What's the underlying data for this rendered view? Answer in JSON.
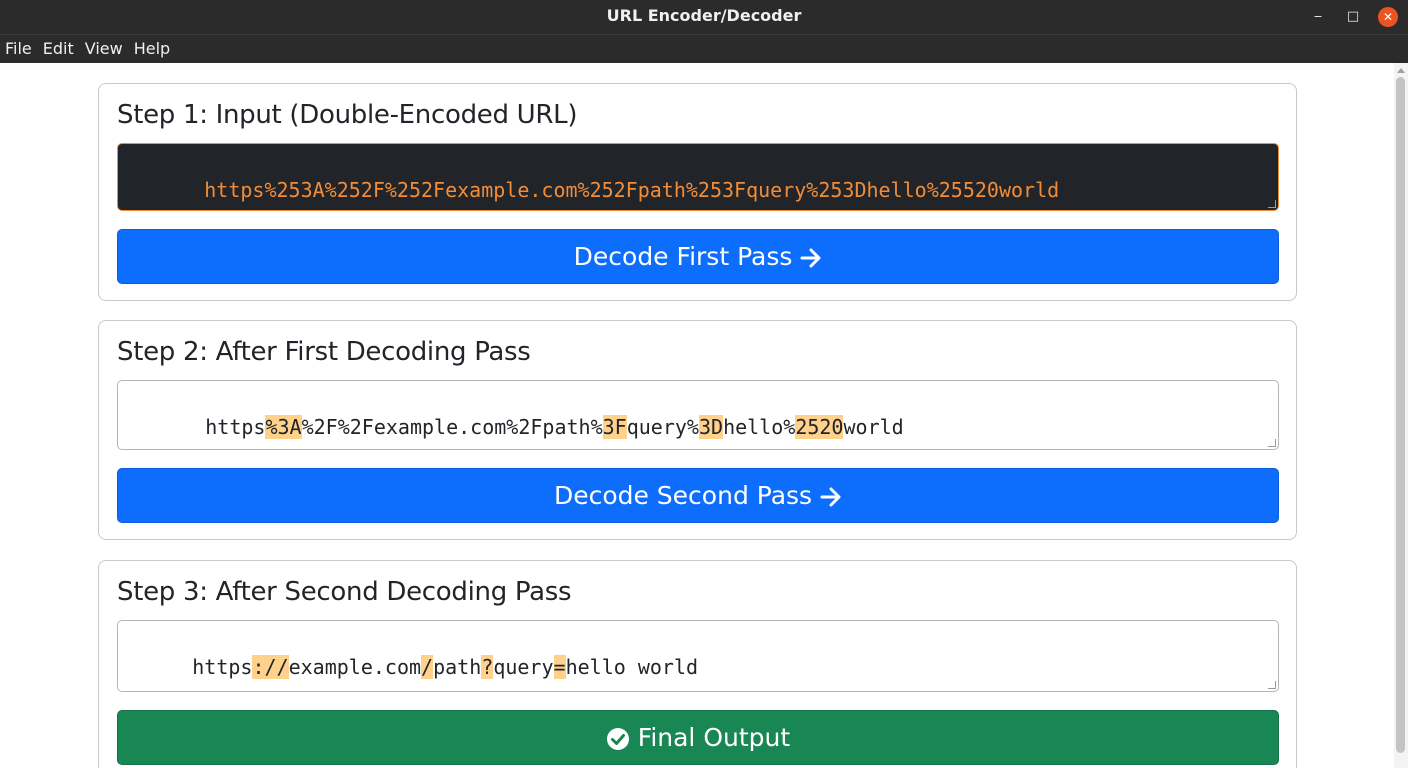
{
  "window": {
    "title": "URL Encoder/Decoder",
    "minimize": "‒",
    "maximize": "□",
    "close": "✕"
  },
  "menu": [
    "File",
    "Edit",
    "View",
    "Help"
  ],
  "steps": [
    {
      "title": "Step 1: Input (Double-Encoded URL)",
      "field_segments": [
        {
          "text": "https%253A%252F%252Fexample.com%252Fpath%253Fquery%253Dhello%25520world",
          "hl": false
        }
      ],
      "button_label": "Decode First Pass"
    },
    {
      "title": "Step 2: After First Decoding Pass",
      "field_segments": [
        {
          "text": "https",
          "hl": false
        },
        {
          "text": "%3A",
          "hl": true
        },
        {
          "text": "%2F%2Fexample.com%2Fpath%",
          "hl": false
        },
        {
          "text": "3F",
          "hl": true
        },
        {
          "text": "query%",
          "hl": false
        },
        {
          "text": "3D",
          "hl": true
        },
        {
          "text": "hello%",
          "hl": false
        },
        {
          "text": "2520",
          "hl": true
        },
        {
          "text": "world",
          "hl": false
        }
      ],
      "button_label": "Decode Second Pass"
    },
    {
      "title": "Step 3: After Second Decoding Pass",
      "field_segments": [
        {
          "text": "https",
          "hl": false
        },
        {
          "text": "://",
          "hl": true
        },
        {
          "text": "example.com",
          "hl": false
        },
        {
          "text": "/",
          "hl": true
        },
        {
          "text": "path",
          "hl": false
        },
        {
          "text": "?",
          "hl": true
        },
        {
          "text": "query",
          "hl": false
        },
        {
          "text": "=",
          "hl": true
        },
        {
          "text": "hello world",
          "hl": false
        }
      ],
      "button_label": "Final Output"
    }
  ],
  "colors": {
    "primary_button": "#0d6efd",
    "success_button": "#198754",
    "dark_field_bg": "#212529",
    "dark_field_text": "#f28c38",
    "highlight": "#ffd18a"
  },
  "icons": {
    "decode_buttons": "arrow-right-icon",
    "final_button": "check-circle-icon"
  }
}
